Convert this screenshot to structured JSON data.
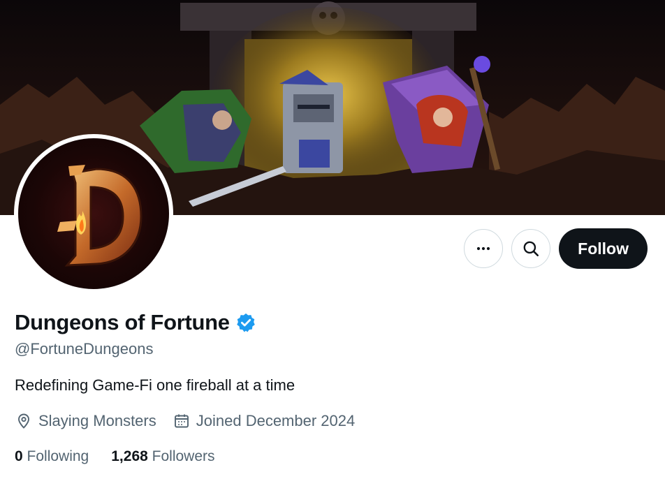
{
  "profile": {
    "display_name": "Dungeons of Fortune",
    "verified_badge": "verified-badge-icon",
    "handle": "@FortuneDungeons",
    "bio": "Redefining Game-Fi one fireball at a time",
    "location": "Slaying Monsters",
    "joined": "Joined December 2024",
    "following_count": "0",
    "following_label": "Following",
    "followers_count": "1,268",
    "followers_label": "Followers"
  },
  "actions": {
    "more_icon": "more-icon",
    "search_icon": "search-icon",
    "follow_label": "Follow"
  },
  "colors": {
    "text_primary": "#0f1419",
    "text_secondary": "#536471",
    "verified_blue": "#1d9bf0",
    "follow_bg": "#0f1419",
    "border": "#cfd9de"
  }
}
